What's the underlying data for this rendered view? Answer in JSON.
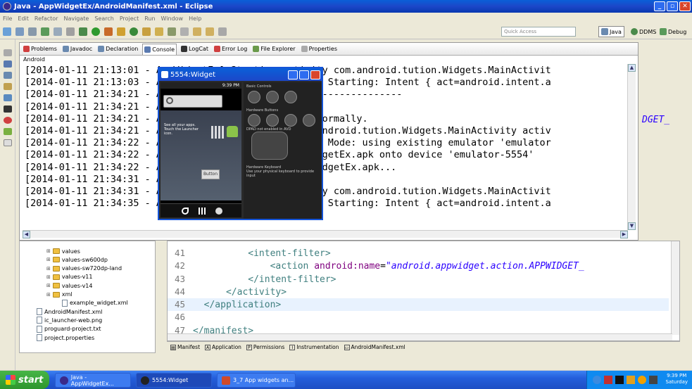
{
  "window": {
    "title": "Java - AppWidgetEx/AndroidManifest.xml - Eclipse"
  },
  "menu": [
    "File",
    "Edit",
    "Refactor",
    "Navigate",
    "Search",
    "Project",
    "Run",
    "Window",
    "Help"
  ],
  "toolbar": {
    "quick_access_placeholder": "Quick Access"
  },
  "perspectives": [
    "Java",
    "DDMS",
    "Debug"
  ],
  "console_view": {
    "tabs": [
      "Problems",
      "Javadoc",
      "Declaration",
      "Console",
      "LogCat",
      "Error Log",
      "File Explorer",
      "Properties"
    ],
    "active_tab": "Console",
    "label": "Android",
    "lines": [
      "[2014-01-11 21:13:01 - AppWidgetEx] Starting activity com.android.tution.Widgets.MainActivit",
      "[2014-01-11 21:13:03 - AppWidgetEx] ActivityManager: Starting: Intent { act=android.intent.a",
      "[2014-01-11 21:34:21 - AppWidgetEx] ------------------------------",
      "[2014-01-11 21:34:21 - AppWidgetEx] Android Launch!",
      "[2014-01-11 21:34:21 - AppWidgetEx] adb is running normally.",
      "[2014-01-11 21:34:21 - AppWidgetEx] Performing com.android.tution.Widgets.MainActivity activ",
      "[2014-01-11 21:34:22 - AppWidgetEx] Automatic Target Mode: using existing emulator 'emulator",
      "[2014-01-11 21:34:22 - AppWidgetEx] Uploading AppWidgetEx.apk onto device 'emulator-5554'",
      "[2014-01-11 21:34:22 - AppWidgetEx] Installing AppWidgetEx.apk...",
      "[2014-01-11 21:34:31 - AppWidgetEx] Success!",
      "[2014-01-11 21:34:31 - AppWidgetEx] Starting activity com.android.tution.Widgets.MainActivit",
      "[2014-01-11 21:34:35 - AppWidgetEx] ActivityManager: Starting: Intent { act=android.intent.a"
    ],
    "overflow_text": "DGET_"
  },
  "emulator": {
    "title": "5554:Widget",
    "status_time": "9:39 PM",
    "tip": "See all your apps. Touch the Launcher icon.",
    "widget_button": "Button",
    "controls": {
      "basic": "Basic Controls",
      "hardware": "Hardware Buttons",
      "dpad": "DPAD not enabled in AVD",
      "keyboard": "Hardware Keyboard",
      "keyboard_hint": "Use your physical keyboard to provide input"
    }
  },
  "project_tree": [
    {
      "label": "values",
      "indent": 0,
      "type": "folder"
    },
    {
      "label": "values-sw600dp",
      "indent": 0,
      "type": "folder"
    },
    {
      "label": "values-sw720dp-land",
      "indent": 0,
      "type": "folder"
    },
    {
      "label": "values-v11",
      "indent": 0,
      "type": "folder"
    },
    {
      "label": "values-v14",
      "indent": 0,
      "type": "folder"
    },
    {
      "label": "xml",
      "indent": 0,
      "type": "folder"
    },
    {
      "label": "example_widget.xml",
      "indent": 1,
      "type": "file"
    },
    {
      "label": "AndroidManifest.xml",
      "indent": -1,
      "type": "file"
    },
    {
      "label": "ic_launcher-web.png",
      "indent": -1,
      "type": "file"
    },
    {
      "label": "proguard-project.txt",
      "indent": -1,
      "type": "file"
    },
    {
      "label": "project.properties",
      "indent": -1,
      "type": "file"
    }
  ],
  "editor": {
    "lines": [
      {
        "n": "41",
        "pre": "          ",
        "parts": [
          [
            "tag",
            "<intent-filter>"
          ]
        ]
      },
      {
        "n": "42",
        "pre": "              ",
        "parts": [
          [
            "tag",
            "<action "
          ],
          [
            "attr",
            "android:name"
          ],
          [
            "plain",
            "="
          ],
          [
            "val",
            "\"android.appwidget.action.APPWIDGET_"
          ]
        ]
      },
      {
        "n": "43",
        "pre": "          ",
        "parts": [
          [
            "tag",
            "</intent-filter>"
          ]
        ]
      },
      {
        "n": "44",
        "pre": "      ",
        "parts": [
          [
            "tag",
            "</activity>"
          ]
        ]
      },
      {
        "n": "45",
        "pre": "  ",
        "parts": [
          [
            "tag",
            "</application>"
          ]
        ]
      },
      {
        "n": "46",
        "pre": "",
        "parts": []
      },
      {
        "n": "47",
        "pre": "",
        "parts": [
          [
            "tag",
            "</manifest>"
          ]
        ]
      }
    ],
    "highlight_line": "45",
    "tabs": [
      "Manifest",
      "Application",
      "Permissions",
      "Instrumentation",
      "AndroidManifest.xml"
    ]
  },
  "taskbar": {
    "start": "start",
    "tasks": [
      "Java - AppWidgetEx...",
      "5554:Widget",
      "3_7 App widgets an..."
    ],
    "clock_time": "9:39 PM",
    "clock_day": "Saturday"
  }
}
